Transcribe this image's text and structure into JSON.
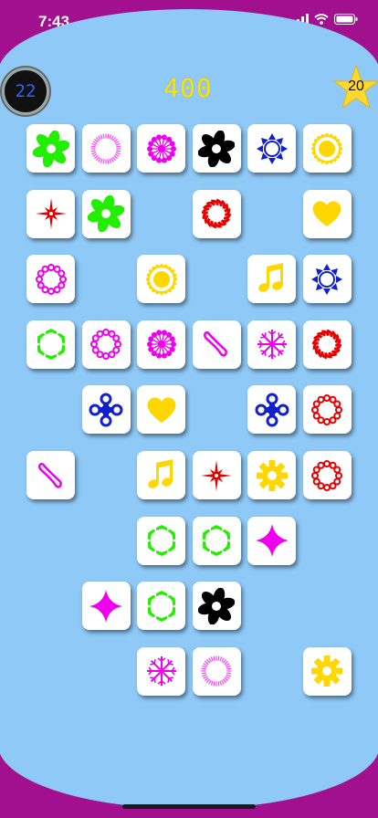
{
  "status": {
    "time": "7:43",
    "icons": [
      "signal-icon",
      "wifi-icon",
      "battery-icon"
    ]
  },
  "game": {
    "timer": "22",
    "score": "400",
    "stars": "20"
  },
  "colors": {
    "background": "#a3108f",
    "board": "#8ec9f7",
    "score": "#ffe100",
    "timer": "#2a63ff"
  },
  "tiles": [
    {
      "row": 0,
      "col": 0,
      "icon": "flower-icon",
      "color": "#22ee00"
    },
    {
      "row": 0,
      "col": 1,
      "icon": "ring-icon",
      "color": "#ff40ff"
    },
    {
      "row": 0,
      "col": 2,
      "icon": "burst-icon",
      "color": "#ee00ee"
    },
    {
      "row": 0,
      "col": 3,
      "icon": "flower-icon",
      "color": "#000000"
    },
    {
      "row": 0,
      "col": 4,
      "icon": "star-ring-icon",
      "color": "#1020d0"
    },
    {
      "row": 0,
      "col": 5,
      "icon": "sun-icon",
      "color": "#ffd700"
    },
    {
      "row": 1,
      "col": 0,
      "icon": "compass-star-icon",
      "color": "#e00000"
    },
    {
      "row": 1,
      "col": 1,
      "icon": "flower-icon",
      "color": "#22ee00"
    },
    {
      "row": 1,
      "col": 3,
      "icon": "swirl-icon",
      "color": "#e80000"
    },
    {
      "row": 1,
      "col": 5,
      "icon": "heart-icon",
      "color": "#ffd700"
    },
    {
      "row": 2,
      "col": 0,
      "icon": "bead-ring-icon",
      "color": "#ee00ee"
    },
    {
      "row": 2,
      "col": 2,
      "icon": "sun-icon",
      "color": "#ffd700"
    },
    {
      "row": 2,
      "col": 4,
      "icon": "music-note-icon",
      "color": "#ffd700"
    },
    {
      "row": 2,
      "col": 5,
      "icon": "star-ring-icon",
      "color": "#1020d0"
    },
    {
      "row": 3,
      "col": 0,
      "icon": "hex-ring-icon",
      "color": "#22ee00"
    },
    {
      "row": 3,
      "col": 1,
      "icon": "bead-ring-icon",
      "color": "#ee00ee"
    },
    {
      "row": 3,
      "col": 2,
      "icon": "burst-icon",
      "color": "#ee00ee"
    },
    {
      "row": 3,
      "col": 3,
      "icon": "infinity-icon",
      "color": "#ee00ee"
    },
    {
      "row": 3,
      "col": 4,
      "icon": "snowflake-icon",
      "color": "#ee00ee"
    },
    {
      "row": 3,
      "col": 5,
      "icon": "swirl-icon",
      "color": "#e80000"
    },
    {
      "row": 4,
      "col": 1,
      "icon": "cross-flower-icon",
      "color": "#1020d0"
    },
    {
      "row": 4,
      "col": 2,
      "icon": "heart-icon",
      "color": "#ffd700"
    },
    {
      "row": 4,
      "col": 4,
      "icon": "cross-flower-icon",
      "color": "#1020d0"
    },
    {
      "row": 4,
      "col": 5,
      "icon": "bead-ring-icon",
      "color": "#e80000"
    },
    {
      "row": 5,
      "col": 0,
      "icon": "infinity-icon",
      "color": "#ee00ee"
    },
    {
      "row": 5,
      "col": 2,
      "icon": "music-note-icon",
      "color": "#ffd700"
    },
    {
      "row": 5,
      "col": 3,
      "icon": "compass-star-icon",
      "color": "#e00000"
    },
    {
      "row": 5,
      "col": 4,
      "icon": "gear-icon",
      "color": "#ffd700"
    },
    {
      "row": 5,
      "col": 5,
      "icon": "bead-ring-icon",
      "color": "#e80000"
    },
    {
      "row": 6,
      "col": 2,
      "icon": "hex-ring-icon",
      "color": "#22ee00"
    },
    {
      "row": 6,
      "col": 3,
      "icon": "hex-ring-icon",
      "color": "#22ee00"
    },
    {
      "row": 6,
      "col": 4,
      "icon": "diamond-star-icon",
      "color": "#ee00ee"
    },
    {
      "row": 7,
      "col": 1,
      "icon": "diamond-star-icon",
      "color": "#ee00ee"
    },
    {
      "row": 7,
      "col": 2,
      "icon": "hex-ring-icon",
      "color": "#22ee00"
    },
    {
      "row": 7,
      "col": 3,
      "icon": "flower-icon",
      "color": "#000000"
    },
    {
      "row": 8,
      "col": 2,
      "icon": "snowflake-icon",
      "color": "#ee00ee"
    },
    {
      "row": 8,
      "col": 3,
      "icon": "ring-icon",
      "color": "#ff40ff"
    },
    {
      "row": 8,
      "col": 5,
      "icon": "gear-icon",
      "color": "#ffd700"
    }
  ]
}
